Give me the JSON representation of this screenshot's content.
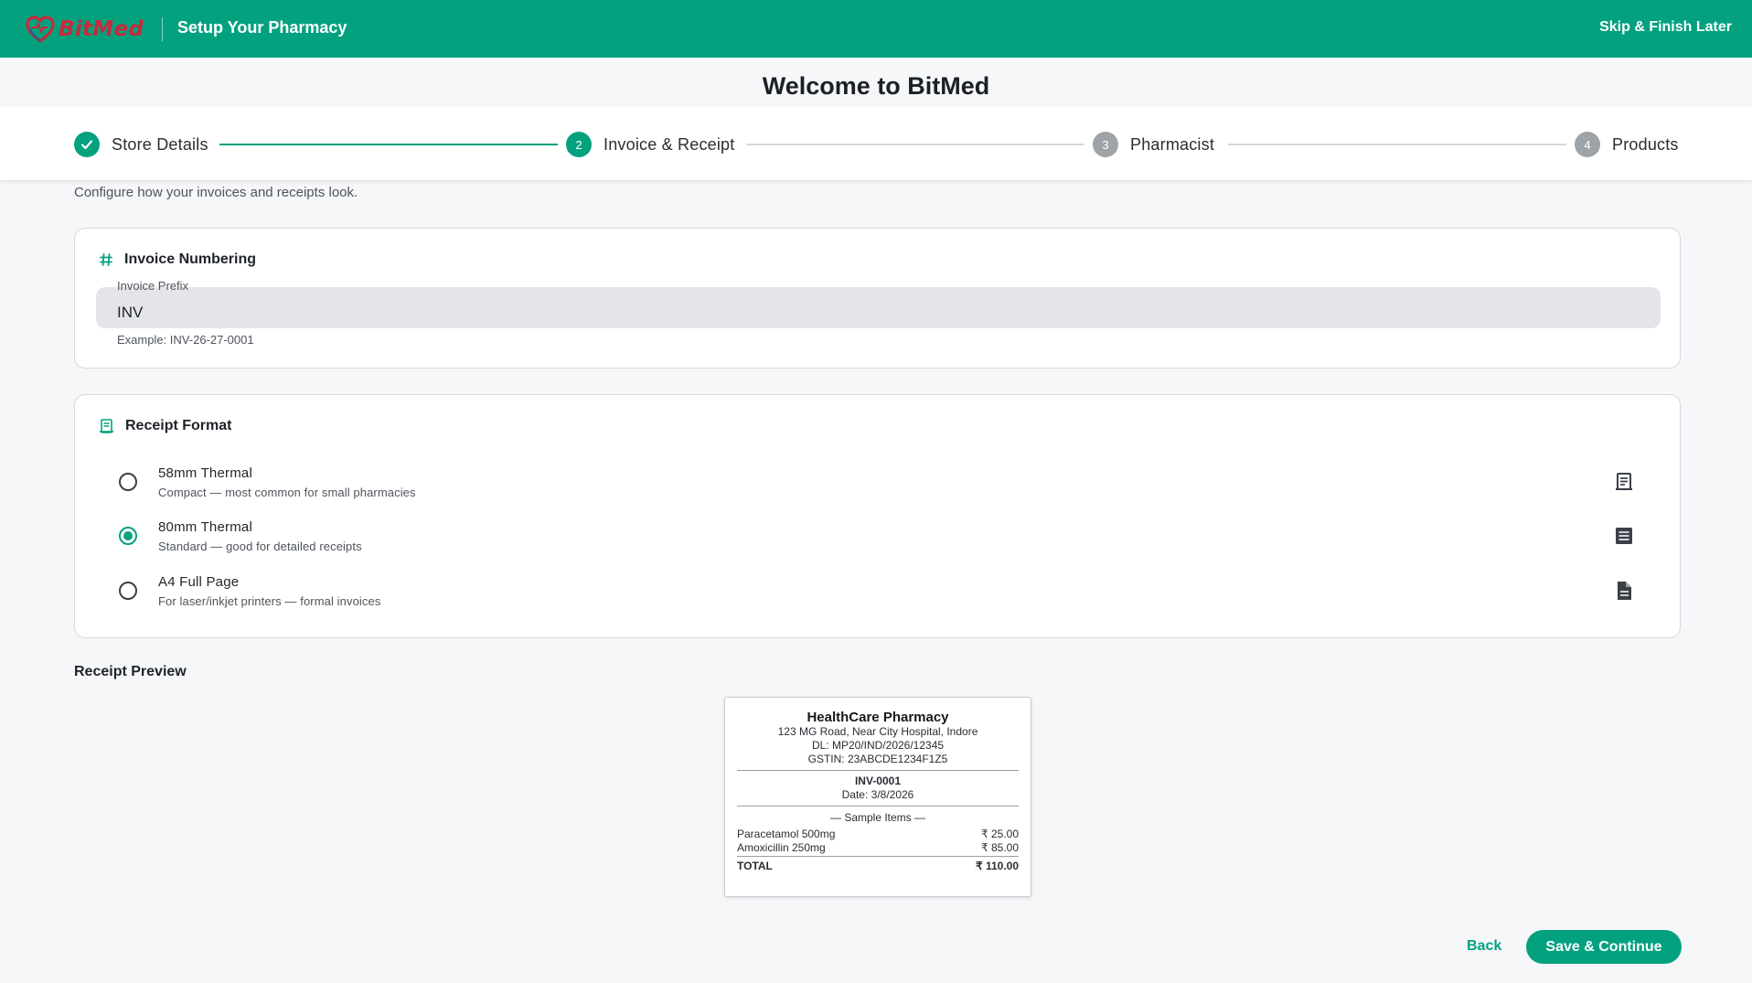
{
  "brand": {
    "name": "BitMed",
    "logo_color": "#c62b3b"
  },
  "topbar": {
    "title": "Setup Your Pharmacy",
    "skip_label": "Skip & Finish Later",
    "bg": "#04a17f"
  },
  "welcome": {
    "title": "Welcome to BitMed"
  },
  "stepper": {
    "steps": [
      {
        "number": "1",
        "label": "Store Details",
        "state": "done",
        "icon": "check-icon"
      },
      {
        "number": "2",
        "label": "Invoice & Receipt",
        "state": "active"
      },
      {
        "number": "3",
        "label": "Pharmacist",
        "state": "pending"
      },
      {
        "number": "4",
        "label": "Products",
        "state": "pending"
      }
    ]
  },
  "subtitle": "Configure how your invoices and receipts look.",
  "invoice_numbering": {
    "title": "Invoice Numbering",
    "icon": "hash-icon",
    "prefix_label": "Invoice Prefix",
    "prefix_value": "INV",
    "example": "Example: INV-26-27-0001"
  },
  "receipt_format": {
    "title": "Receipt Format",
    "icon": "receipt-icon",
    "selected": "80mm Thermal",
    "options": [
      {
        "title": "58mm Thermal",
        "desc": "Compact — most common for small pharmacies",
        "icon": "receipt-icon",
        "checked": false
      },
      {
        "title": "80mm Thermal",
        "desc": "Standard — good for detailed receipts",
        "icon": "list-icon",
        "checked": true
      },
      {
        "title": "A4 Full Page",
        "desc": "For laser/inkjet printers — formal invoices",
        "icon": "document-icon",
        "checked": false
      }
    ]
  },
  "preview": {
    "title": "Receipt Preview",
    "store_name": "HealthCare Pharmacy",
    "address": "123 MG Road, Near City Hospital, Indore",
    "dl": "DL: MP20/IND/2026/12345",
    "gstin": "GSTIN: 23ABCDE1234F1Z5",
    "invoice_no": "INV-0001",
    "date": "Date: 3/8/2026",
    "sample_label": "— Sample Items —",
    "items": [
      {
        "name": "Paracetamol 500mg",
        "price": "₹ 25.00"
      },
      {
        "name": "Amoxicillin 250mg",
        "price": "₹ 85.00"
      }
    ],
    "total_label": "TOTAL",
    "total_value": "₹ 110.00"
  },
  "actions": {
    "back_label": "Back",
    "save_label": "Save & Continue"
  }
}
